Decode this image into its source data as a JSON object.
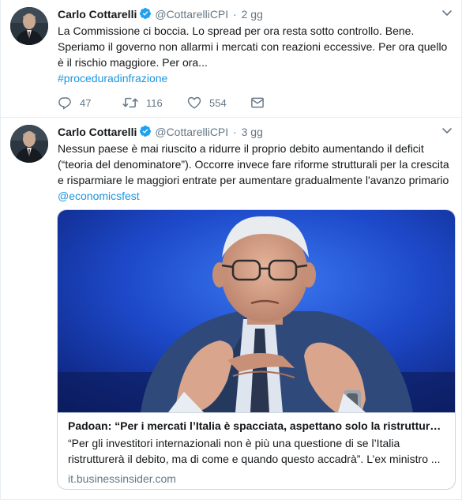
{
  "tweets": [
    {
      "author_name": "Carlo Cottarelli",
      "author_handle": "@CottarelliCPI",
      "separator": "·",
      "time": "2 gg",
      "text": "La Commissione ci boccia. Lo spread per ora resta sotto controllo. Bene. Speriamo il governo non allarmi i mercati con reazioni eccessive. Per ora quello è il rischio maggiore. Per ora...",
      "hashtag": "#proceduradinfrazione",
      "replies": "47",
      "retweets": "116",
      "likes": "554"
    },
    {
      "author_name": "Carlo Cottarelli",
      "author_handle": "@CottarelliCPI",
      "separator": "·",
      "time": "3 gg",
      "text": "Nessun paese è mai riuscito a ridurre il proprio debito aumentando il deficit (“teoria del denominatore”). Occorre invece fare riforme strutturali per la crescita e risparmiare le maggiori entrate per aumentare gradualmente l'avanzo primario",
      "mention": "@economicsfest",
      "card": {
        "title": "Padoan: “Per i mercati l’Italia è spacciata, aspettano solo la ristruttur…",
        "description": "“Per gli investitori internazionali non è più una questione di se l’Italia ristrutturerà il debito, ma di come e quando questo accadrà”. L’ex ministro ...",
        "domain": "it.businessinsider.com"
      }
    }
  ],
  "colors": {
    "link": "#1b95e0",
    "secondary_text": "#657786",
    "border": "#e6ecf0",
    "verified": "#1da1f2",
    "card_bg_blue": "#1d49c9"
  },
  "icons": {
    "reply": "speech-bubble",
    "retweet": "retweet-arrows",
    "like": "heart-outline",
    "dm": "envelope",
    "verified": "verified-badge",
    "menu": "chevron-down"
  }
}
